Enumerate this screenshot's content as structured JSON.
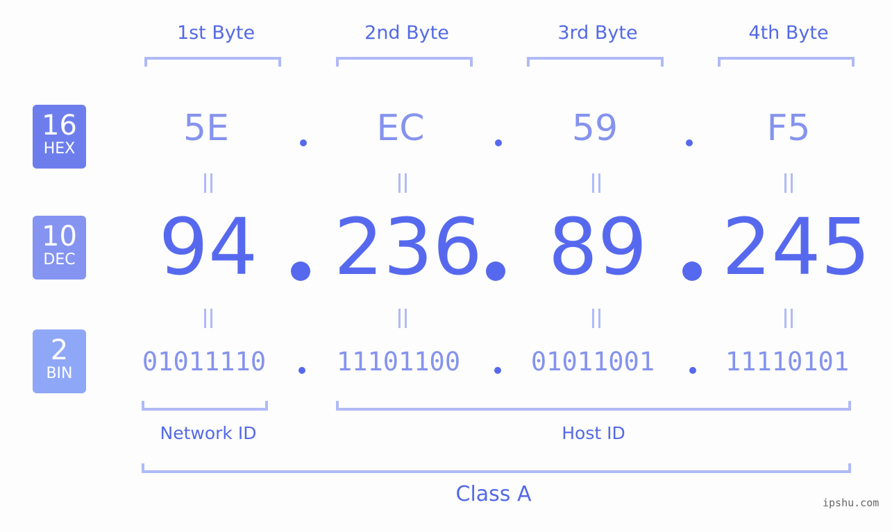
{
  "bytes": [
    {
      "header": "1st Byte",
      "hex": "5E",
      "dec": "94",
      "bin": "01011110"
    },
    {
      "header": "2nd Byte",
      "hex": "EC",
      "dec": "236",
      "bin": "11101100"
    },
    {
      "header": "3rd Byte",
      "hex": "59",
      "dec": "89",
      "bin": "01011001"
    },
    {
      "header": "4th Byte",
      "hex": "F5",
      "dec": "245",
      "bin": "11110101"
    }
  ],
  "badges": {
    "hex": {
      "num": "16",
      "label": "HEX",
      "color": "#6d7eec"
    },
    "dec": {
      "num": "10",
      "label": "DEC",
      "color": "#8594f1"
    },
    "bin": {
      "num": "2",
      "label": "BIN",
      "color": "#8fa7f7"
    }
  },
  "labels": {
    "network_id": "Network ID",
    "host_id": "Host ID",
    "class": "Class A"
  },
  "watermark": "ipshu.com",
  "colors": {
    "accent": "#5669ee",
    "light": "#8593ee",
    "bracket": "#b0baf7"
  }
}
